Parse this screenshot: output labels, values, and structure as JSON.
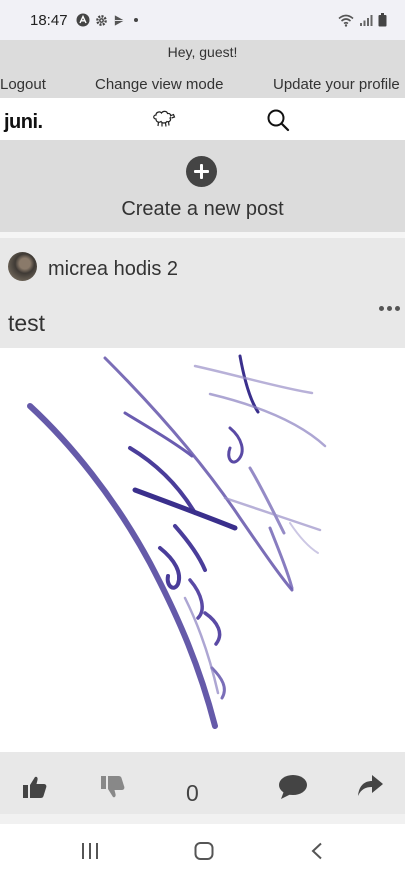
{
  "status_bar": {
    "time": "18:47",
    "icons": [
      "app-notification-icon",
      "settings-icon",
      "play-icon",
      "dot-icon",
      "wifi-icon",
      "signal-icon",
      "battery-icon"
    ]
  },
  "greeting": {
    "text": "Hey, guest!",
    "logout": "Logout",
    "change_view": "Change view mode",
    "update_profile": "Update your profile"
  },
  "app_bar": {
    "logo": "juni.",
    "icons": [
      "sheep-icon",
      "search-icon"
    ]
  },
  "create_post": {
    "label": "Create a new post",
    "icon": "plus-icon"
  },
  "post": {
    "author": "micrea hodis 2",
    "title": "test",
    "image_alt": "handwritten signature drawing",
    "reactions": {
      "count": "0",
      "icons": [
        "thumbs-up-icon",
        "thumbs-down-icon",
        "comment-icon",
        "share-icon"
      ]
    }
  },
  "nav_bar": {
    "icons": [
      "recents-icon",
      "home-icon",
      "back-icon"
    ]
  },
  "colors": {
    "status_bg": "#f1f1f6",
    "gray_bar": "#dcdcdc",
    "post_bg": "#e8e8e8",
    "ink": "#3a2f8c"
  }
}
